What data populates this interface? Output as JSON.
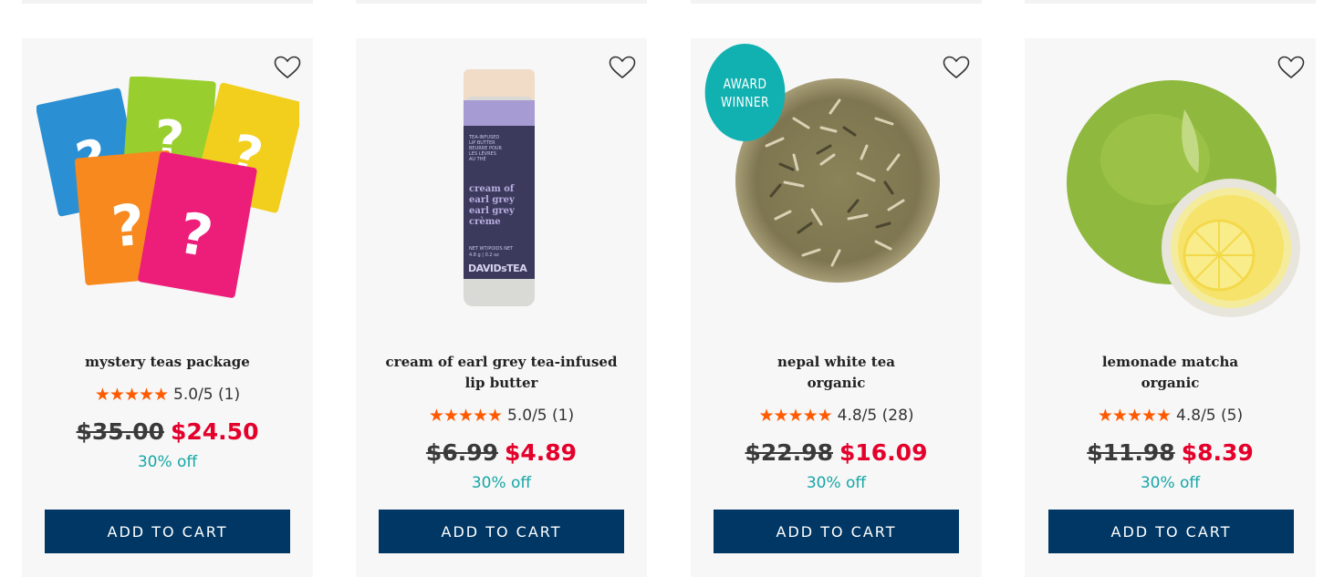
{
  "products": [
    {
      "name": "mystery teas package",
      "subtitle": "",
      "stars": "★★★★★",
      "rating": "5.0/5 (1)",
      "old_price": "$35.00",
      "new_price": "$24.50",
      "discount": "30% off",
      "button": "ADD TO CART"
    },
    {
      "name": "cream of earl grey tea-infused",
      "subtitle": "lip butter",
      "stars": "★★★★★",
      "rating": "5.0/5 (1)",
      "old_price": "$6.99",
      "new_price": "$4.89",
      "discount": "30% off",
      "button": "ADD TO CART",
      "package_text": {
        "small_lines": [
          "TEA-INFUSED",
          "LIP BUTTER",
          "BEURRE POUR",
          "LES LÈVRES",
          "AU THÉ"
        ],
        "name_lines": [
          "cream of",
          "earl grey",
          "earl grey",
          "crème"
        ],
        "weight": [
          "NET WT/POIDS NET",
          "4.8 g | 0.2 oz"
        ],
        "brand": "DAVIDsTEA"
      }
    },
    {
      "name": "nepal white tea",
      "subtitle": "organic",
      "stars": "★★★★★",
      "rating": "4.8/5 (28)",
      "old_price": "$22.98",
      "new_price": "$16.09",
      "discount": "30% off",
      "button": "ADD TO CART",
      "badge": [
        "AWARD",
        "WINNER"
      ]
    },
    {
      "name": "lemonade matcha",
      "subtitle": "organic",
      "stars": "★★★★★",
      "rating": "4.8/5 (5)",
      "old_price": "$11.98",
      "new_price": "$8.39",
      "discount": "30% off",
      "button": "ADD TO CART"
    }
  ],
  "icons": {
    "wishlist": "heart-outline-icon",
    "rating": "star-icon"
  },
  "colors": {
    "star": "#ff5a00",
    "sale_price": "#e4002b",
    "discount": "#16a6a6",
    "button": "#003764",
    "badge": "#12b1b1",
    "card": "#f7f7f7"
  }
}
